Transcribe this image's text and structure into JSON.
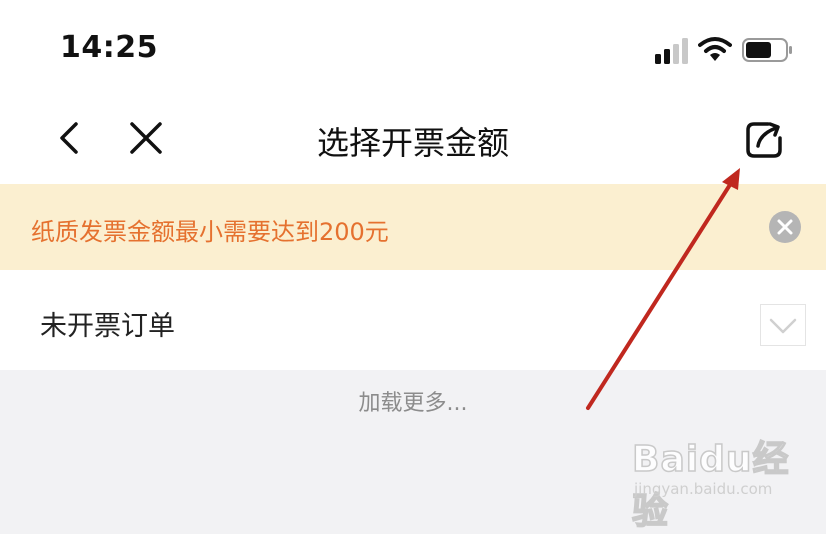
{
  "status_bar": {
    "time": "14:25",
    "signal_icon": "cellular-signal-icon",
    "wifi_icon": "wifi-icon",
    "battery_icon": "battery-icon"
  },
  "nav": {
    "title": "选择开票金额",
    "back_icon": "chevron-left-icon",
    "close_icon": "close-icon",
    "share_icon": "share-icon"
  },
  "notice": {
    "text": "纸质发票金额最小需要达到200元",
    "close_icon": "close-circle-icon",
    "text_color": "#e5712f",
    "background": "#fbefd0"
  },
  "orders": {
    "label": "未开票订单",
    "toggle_icon": "chevron-down-icon"
  },
  "load_more": "加载更多...",
  "watermark": {
    "logo": "Baidu经验",
    "url": "jingyan.baidu.com"
  },
  "annotation": {
    "arrow_color": "#c0281f"
  }
}
